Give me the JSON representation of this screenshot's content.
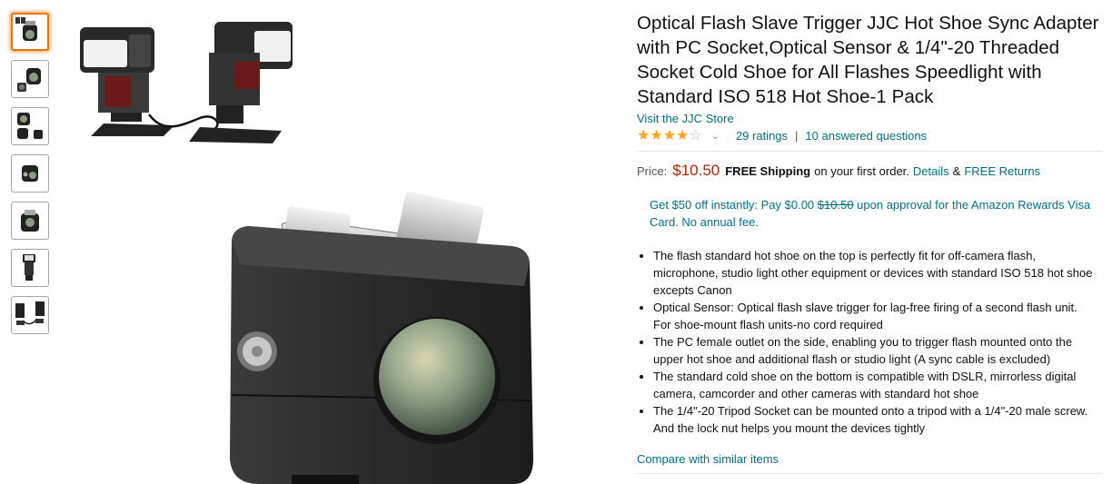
{
  "product": {
    "title": "Optical Flash Slave Trigger JJC Hot Shoe Sync Adapter with PC Socket,Optical Sensor & 1/4\"-20 Threaded Socket Cold Shoe for All Flashes Speedlight with Standard ISO 518 Hot Shoe-1 Pack",
    "store_link": "Visit the JJC Store",
    "rating": 3.5,
    "ratings_count": "29 ratings",
    "separator": "|",
    "answered_questions": "10 answered questions"
  },
  "price": {
    "label": "Price:",
    "amount": "$10.50",
    "free_shipping": "FREE Shipping",
    "shipping_suffix": "on your first order.",
    "details_link": "Details",
    "ampersand": "&",
    "returns_link": "FREE Returns"
  },
  "promo": {
    "prefix": "Get $50 off instantly: Pay $0.00",
    "struck_price": "$10.50",
    "suffix": "upon approval for the Amazon Rewards Visa Card. No annual fee."
  },
  "bullets": [
    "The flash standard hot shoe on the top is perfectly fit for off-camera flash, microphone, studio light other equipment or devices with standard ISO 518 hot shoe excepts Canon",
    "Optical Sensor: Optical flash slave trigger for lag-free firing of a second flash unit. For shoe-mount flash units-no cord required",
    "The PC female outlet on the side, enabling you to trigger flash mounted onto the upper hot shoe and additional flash or studio light (A sync cable is excluded)",
    "The standard cold shoe on the bottom is compatible with DSLR, mirrorless digital camera, camcorder and other cameras with standard hot shoe",
    "The 1/4\"-20 Tripod Socket can be mounted onto a tripod with a 1/4\"-20 male screw. And the lock nut helps you mount the devices tightly"
  ],
  "compare_link": "Compare with similar items",
  "thumbnails": [
    "flash-pair",
    "adapter-front",
    "adapter-set",
    "adapter-side",
    "adapter-top",
    "flash-mounted",
    "flash-pair-cable"
  ],
  "colors": {
    "link": "#007185",
    "price": "#B12704",
    "star": "#FFA41C",
    "selected_thumb": "#e77600"
  }
}
